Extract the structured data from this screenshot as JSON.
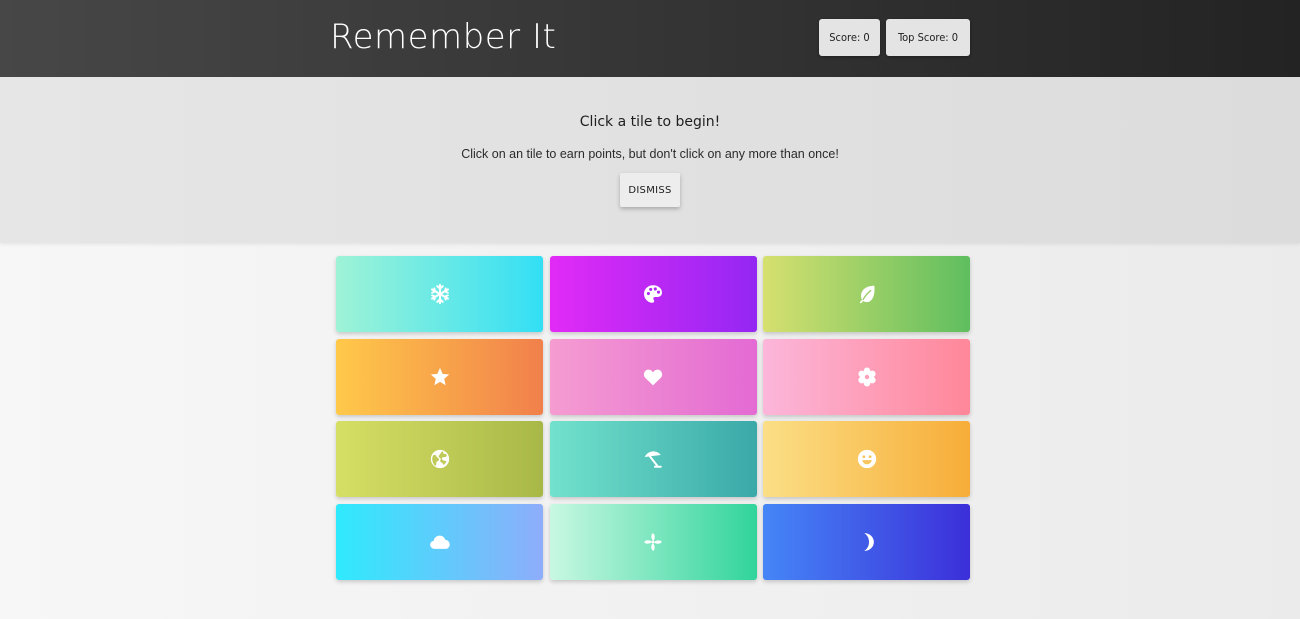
{
  "header": {
    "title": "Remember It",
    "score_label": "Score: 0",
    "top_score_label": "Top Score: 0"
  },
  "banner": {
    "heading": "Click a tile to begin!",
    "message": "Click on an tile to earn points, but don't click on any more than once!",
    "dismiss_label": "DISMISS"
  },
  "tiles": [
    {
      "icon": "snowflake-icon",
      "gradient": [
        "#9ff3d6",
        "#33dff5"
      ]
    },
    {
      "icon": "palette-icon",
      "gradient": [
        "#e22af6",
        "#9427f3"
      ]
    },
    {
      "icon": "leaf-icon",
      "gradient": [
        "#d6e06f",
        "#5fbe5f"
      ]
    },
    {
      "icon": "star-icon",
      "gradient": [
        "#ffc94a",
        "#f1804b"
      ]
    },
    {
      "icon": "heart-icon",
      "gradient": [
        "#f59cd1",
        "#e36ad3"
      ]
    },
    {
      "icon": "flower-icon",
      "gradient": [
        "#fcb6da",
        "#ff8799"
      ]
    },
    {
      "icon": "globe-icon",
      "gradient": [
        "#d6df65",
        "#a8b847"
      ]
    },
    {
      "icon": "umbrella-beach-icon",
      "gradient": [
        "#72e2cd",
        "#3aa9a8"
      ]
    },
    {
      "icon": "smile-icon",
      "gradient": [
        "#fbdf86",
        "#f7ad38"
      ]
    },
    {
      "icon": "cloud-icon",
      "gradient": [
        "#2feafc",
        "#8eadfb"
      ]
    },
    {
      "icon": "pinwheel-icon",
      "gradient": [
        "#c8f8e2",
        "#31d49c"
      ]
    },
    {
      "icon": "moon-icon",
      "gradient": [
        "#4586f7",
        "#3c2fd9"
      ]
    }
  ]
}
